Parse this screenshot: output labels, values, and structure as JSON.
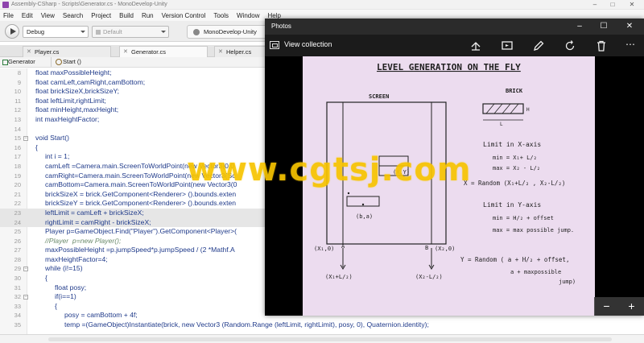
{
  "app": {
    "window_title": "Assembly-CSharp - Scripts\\Generator.cs - MonoDevelop-Unity",
    "menu": [
      "File",
      "Edit",
      "View",
      "Search",
      "Project",
      "Build",
      "Run",
      "Version Control",
      "Tools",
      "Window",
      "Help"
    ],
    "toolbar": {
      "configuration": "Debug",
      "platform": "Default",
      "status": "MonoDevelop-Unity"
    },
    "tabs": [
      {
        "label": "Player.cs"
      },
      {
        "label": "Generator.cs"
      },
      {
        "label": "Helper.cs"
      }
    ],
    "path": {
      "class": "Generator",
      "method": "Start ()"
    },
    "colors": {
      "keyword": "#1f3a8a",
      "comment": "#6a8a6a",
      "highlight": "#e6e6e6"
    }
  },
  "editor": {
    "lines": [
      {
        "n": "8",
        "text": "float maxPossibleHeight;",
        "fold": "",
        "indent": 0
      },
      {
        "n": "9",
        "text": "float camLeft,camRight,camBottom;",
        "fold": "",
        "indent": 0
      },
      {
        "n": "10",
        "text": "float brickSizeX,brickSizeY;",
        "fold": "",
        "indent": 0
      },
      {
        "n": "11",
        "text": "float leftLimit,rightLimit;",
        "fold": "",
        "indent": 0
      },
      {
        "n": "12",
        "text": "float minHeight,maxHeight;",
        "fold": "",
        "indent": 0
      },
      {
        "n": "13",
        "text": "int maxHeightFactor;",
        "fold": "",
        "indent": 0
      },
      {
        "n": "14",
        "text": "",
        "fold": "",
        "indent": 0
      },
      {
        "n": "15",
        "text": "void Start()",
        "fold": "−",
        "indent": 0
      },
      {
        "n": "16",
        "text": "{",
        "fold": "",
        "indent": 0
      },
      {
        "n": "17",
        "text": "int i = 1;",
        "fold": "",
        "indent": 1
      },
      {
        "n": "18",
        "text": "camLeft =Camera.main.ScreenToWorldPoint(new Vector3(0,0",
        "fold": "",
        "indent": 1
      },
      {
        "n": "19",
        "text": "camRight=Camera.main.ScreenToWorldPoint(new Vector3(Sc",
        "fold": "",
        "indent": 1
      },
      {
        "n": "20",
        "text": "camBottom=Camera.main.ScreenToWorldPoint(new Vector3(0",
        "fold": "",
        "indent": 1
      },
      {
        "n": "21",
        "text": "brickSizeX = brick.GetComponent<Renderer> ().bounds.exten",
        "fold": "",
        "indent": 1
      },
      {
        "n": "22",
        "text": "brickSizeY = brick.GetComponent<Renderer> ().bounds.exten",
        "fold": "",
        "indent": 1
      },
      {
        "n": "23",
        "text": "leftLimit = camLeft + brickSizeX;",
        "fold": "",
        "indent": 1,
        "hl": true
      },
      {
        "n": "24",
        "text": "rightLimit = camRight - brickSizeX;",
        "fold": "",
        "indent": 1,
        "hl": true
      },
      {
        "n": "25",
        "text": "Player p=GameObject.Find(\"Player\").GetComponent<Player>(",
        "fold": "",
        "indent": 1
      },
      {
        "n": "26",
        "text": "//Player  p=new Player();",
        "fold": "",
        "indent": 1,
        "comment": true
      },
      {
        "n": "27",
        "text": "maxPossibleHeight =p.jumpSpeed*p.jumpSpeed / (2 *Mathf.A",
        "fold": "",
        "indent": 1
      },
      {
        "n": "28",
        "text": "maxHeightFactor=4;",
        "fold": "",
        "indent": 1
      },
      {
        "n": "29",
        "text": "while (i!=15)",
        "fold": "−",
        "indent": 1
      },
      {
        "n": "30",
        "text": "{",
        "fold": "",
        "indent": 1
      },
      {
        "n": "31",
        "text": "float posy;",
        "fold": "",
        "indent": 2
      },
      {
        "n": "32",
        "text": "if(i==1)",
        "fold": "−",
        "indent": 2
      },
      {
        "n": "33",
        "text": "{",
        "fold": "",
        "indent": 2
      },
      {
        "n": "34",
        "text": "posy = camBottom + 4f;",
        "fold": "",
        "indent": 3
      },
      {
        "n": "35",
        "text": "temp =(GameObject)Instantiate(brick, new Vector3 (Random.Range (leftLimit, rightLimit), posy, 0), Quaternion.identity);",
        "fold": "",
        "indent": 3
      }
    ]
  },
  "photos": {
    "title": "Photos",
    "view_collection": "View collection",
    "tools": [
      "share-icon",
      "slideshow-icon",
      "edit-icon",
      "rotate-icon",
      "delete-icon",
      "more-icon"
    ],
    "zoom_out": "−",
    "zoom_in": "+",
    "note": {
      "heading": "LEVEL GENERATION  ON THE FLY",
      "screen_label": "SCREEN",
      "brick_label": "BRICK",
      "brick_h": "H",
      "brick_l": "L",
      "ba_label": "(b,a)",
      "xy_label": "(X,Y)",
      "x0_label": "(X₁,0)",
      "x2_label": "(X₂,0)",
      "ax_label": "A",
      "bx_label": "B",
      "bl_label": "(X₁+L/₂)",
      "br_label": "(X₂-L/₂)",
      "limit_x": "Limit  in  X-axis",
      "min_x": "min  =   X₁+ L/₂",
      "max_x": "max  =   X₂ - L/₂",
      "rand_x": "X = Random (X₁+L/₂ , X₂-L/₂)",
      "limit_y": "Limit  in  Y-axis",
      "min_y": "min  =   H/₂ + offset",
      "max_y": "max  =   max possible jump.",
      "rand_y": "Y = Random ( a + H/₂ + offset,",
      "rand_y2": "a + maxpossible",
      "rand_y3": "jump)"
    }
  },
  "watermark": "www.cgtsj.com"
}
